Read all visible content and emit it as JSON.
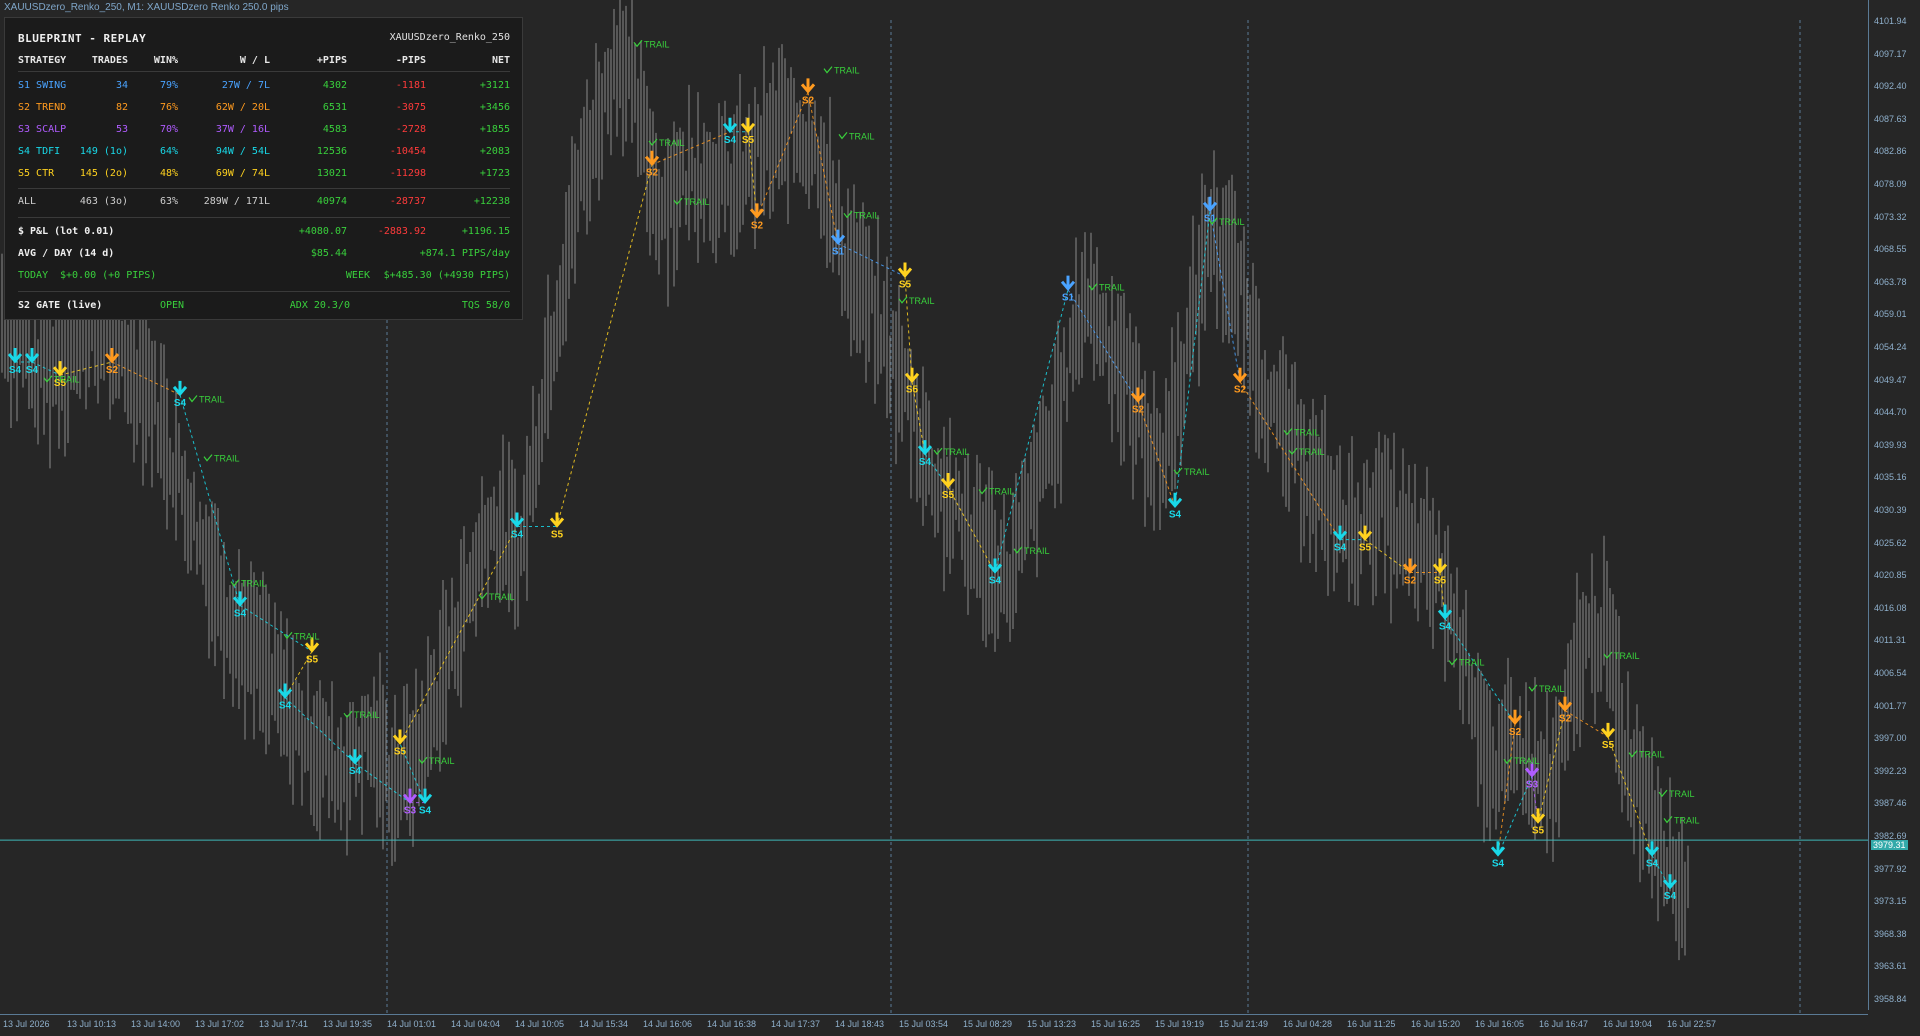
{
  "window": {
    "title": "XAUUSDzero_Renko_250, M1:  XAUUSDzero Renko 250.0 pips"
  },
  "panel": {
    "title": "BLUEPRINT - REPLAY",
    "symbol": "XAUUSDzero_Renko_250",
    "headers": [
      "STRATEGY",
      "TRADES",
      "WIN%",
      "W / L",
      "+PIPS",
      "-PIPS",
      "NET"
    ],
    "rows": [
      {
        "strategy": "S1 SWING",
        "trades": "34",
        "win": "79%",
        "wl": "27W / 7L",
        "plus": "4302",
        "minus": "-1181",
        "net": "+3121",
        "color": "#4aa3ff"
      },
      {
        "strategy": "S2 TREND",
        "trades": "82",
        "win": "76%",
        "wl": "62W / 20L",
        "plus": "6531",
        "minus": "-3075",
        "net": "+3456",
        "color": "#ff9a1f"
      },
      {
        "strategy": "S3 SCALP",
        "trades": "53",
        "win": "70%",
        "wl": "37W / 16L",
        "plus": "4583",
        "minus": "-2728",
        "net": "+1855",
        "color": "#b05cff"
      },
      {
        "strategy": "S4 TDFI",
        "trades": "149 (1o)",
        "win": "64%",
        "wl": "94W / 54L",
        "plus": "12536",
        "minus": "-10454",
        "net": "+2083",
        "color": "#19d8e8"
      },
      {
        "strategy": "S5 CTR",
        "trades": "145 (2o)",
        "win": "48%",
        "wl": "69W / 74L",
        "plus": "13021",
        "minus": "-11298",
        "net": "+1723",
        "color": "#ffd21f"
      }
    ],
    "total": {
      "strategy": "ALL",
      "trades": "463 (3o)",
      "win": "63%",
      "wl": "289W / 171L",
      "plus": "40974",
      "minus": "-28737",
      "net": "+12238"
    },
    "pnl": {
      "label": "$ P&L (lot 0.01)",
      "plus": "+4080.07",
      "minus": "-2883.92",
      "net": "+1196.15"
    },
    "avg": {
      "label": "AVG / DAY (14 d)",
      "value": "$85.44",
      "pips": "+874.1 PIPS/day"
    },
    "today": {
      "label": "TODAY",
      "value": "$+0.00 (+0 PIPS)",
      "week_label": "WEEK",
      "week_value": "$+485.30 (+4930 PIPS)"
    },
    "gate": {
      "label": "S2 GATE (live)",
      "status": "OPEN",
      "adx": "ADX 20.3/0",
      "tqs": "TQS 58/0"
    }
  },
  "axis": {
    "prices": [
      "4101.94",
      "4097.17",
      "4092.40",
      "4087.63",
      "4082.86",
      "4078.09",
      "4073.32",
      "4068.55",
      "4063.78",
      "4059.01",
      "4054.24",
      "4049.47",
      "4044.70",
      "4039.93",
      "4035.16",
      "4030.39",
      "4025.62",
      "4020.85",
      "4016.08",
      "4011.31",
      "4006.54",
      "4001.77",
      "3997.00",
      "3992.23",
      "3987.46",
      "3982.69",
      "3977.92",
      "3973.15",
      "3968.38",
      "3963.61",
      "3958.84"
    ],
    "current_price": "3979.31",
    "times": [
      "13 Jul 2026",
      "13 Jul 10:13",
      "13 Jul 14:00",
      "13 Jul 17:02",
      "13 Jul 17:41",
      "13 Jul 19:35",
      "14 Jul 01:01",
      "14 Jul 04:04",
      "14 Jul 10:05",
      "14 Jul 15:34",
      "14 Jul 16:06",
      "14 Jul 16:38",
      "14 Jul 17:37",
      "14 Jul 18:43",
      "15 Jul 03:54",
      "15 Jul 08:29",
      "15 Jul 13:23",
      "15 Jul 16:25",
      "15 Jul 19:19",
      "15 Jul 21:49",
      "16 Jul 04:28",
      "16 Jul 11:25",
      "16 Jul 15:20",
      "16 Jul 16:05",
      "16 Jul 16:47",
      "16 Jul 19:04",
      "16 Jul 22:57"
    ]
  },
  "chart_data": {
    "type": "line",
    "xlabel": "",
    "ylabel": "",
    "ylim": [
      3955,
      4104
    ],
    "current_price": 3979.31,
    "price_path": [
      [
        0,
        4060
      ],
      [
        40,
        4050
      ],
      [
        100,
        4058
      ],
      [
        150,
        4048
      ],
      [
        200,
        4025
      ],
      [
        235,
        4012
      ],
      [
        270,
        4004
      ],
      [
        300,
        3996
      ],
      [
        340,
        3990
      ],
      [
        370,
        3995
      ],
      [
        395,
        3988
      ],
      [
        420,
        3993
      ],
      [
        450,
        4008
      ],
      [
        490,
        4028
      ],
      [
        520,
        4022
      ],
      [
        545,
        4050
      ],
      [
        580,
        4080
      ],
      [
        620,
        4100
      ],
      [
        640,
        4088
      ],
      [
        660,
        4076
      ],
      [
        700,
        4082
      ],
      [
        730,
        4078
      ],
      [
        760,
        4084
      ],
      [
        790,
        4088
      ],
      [
        820,
        4084
      ],
      [
        840,
        4070
      ],
      [
        880,
        4057
      ],
      [
        910,
        4046
      ],
      [
        935,
        4034
      ],
      [
        960,
        4028
      ],
      [
        990,
        4022
      ],
      [
        1010,
        4019
      ],
      [
        1030,
        4030
      ],
      [
        1060,
        4045
      ],
      [
        1085,
        4063
      ],
      [
        1110,
        4055
      ],
      [
        1140,
        4044
      ],
      [
        1160,
        4036
      ],
      [
        1185,
        4052
      ],
      [
        1210,
        4073
      ],
      [
        1240,
        4063
      ],
      [
        1270,
        4045
      ],
      [
        1300,
        4038
      ],
      [
        1320,
        4032
      ],
      [
        1350,
        4026
      ],
      [
        1380,
        4030
      ],
      [
        1410,
        4024
      ],
      [
        1440,
        4020
      ],
      [
        1470,
        4005
      ],
      [
        1495,
        3985
      ],
      [
        1510,
        3996
      ],
      [
        1530,
        3990
      ],
      [
        1555,
        3987
      ],
      [
        1580,
        4008
      ],
      [
        1605,
        4012
      ],
      [
        1625,
        3993
      ],
      [
        1650,
        3985
      ],
      [
        1680,
        3972
      ]
    ],
    "signals": [
      {
        "label": "S4",
        "x": 15,
        "y": 4052,
        "color": "#19d8e8"
      },
      {
        "label": "S4",
        "x": 32,
        "y": 4052,
        "color": "#19d8e8"
      },
      {
        "label": "S5",
        "x": 60,
        "y": 4050,
        "color": "#ffd21f"
      },
      {
        "label": "S2",
        "x": 112,
        "y": 4052,
        "color": "#ff9a1f"
      },
      {
        "label": "S4",
        "x": 180,
        "y": 4047,
        "color": "#19d8e8"
      },
      {
        "label": "S4",
        "x": 240,
        "y": 4015,
        "color": "#19d8e8"
      },
      {
        "label": "S5",
        "x": 312,
        "y": 4008,
        "color": "#ffd21f"
      },
      {
        "label": "S4",
        "x": 285,
        "y": 4001,
        "color": "#19d8e8"
      },
      {
        "label": "S4",
        "x": 355,
        "y": 3991,
        "color": "#19d8e8"
      },
      {
        "label": "S3",
        "x": 410,
        "y": 3985,
        "color": "#b05cff"
      },
      {
        "label": "S4",
        "x": 425,
        "y": 3985,
        "color": "#19d8e8"
      },
      {
        "label": "S5",
        "x": 400,
        "y": 3994,
        "color": "#ffd21f"
      },
      {
        "label": "S4",
        "x": 517,
        "y": 4027,
        "color": "#19d8e8"
      },
      {
        "label": "S5",
        "x": 557,
        "y": 4027,
        "color": "#ffd21f"
      },
      {
        "label": "S2",
        "x": 652,
        "y": 4082,
        "color": "#ff9a1f"
      },
      {
        "label": "S4",
        "x": 730,
        "y": 4087,
        "color": "#19d8e8"
      },
      {
        "label": "S5",
        "x": 748,
        "y": 4087,
        "color": "#ffd21f"
      },
      {
        "label": "S2",
        "x": 757,
        "y": 4074,
        "color": "#ff9a1f"
      },
      {
        "label": "S2",
        "x": 808,
        "y": 4093,
        "color": "#ff9a1f"
      },
      {
        "label": "S1",
        "x": 838,
        "y": 4070,
        "color": "#4aa3ff"
      },
      {
        "label": "S5",
        "x": 905,
        "y": 4065,
        "color": "#ffd21f"
      },
      {
        "label": "S5",
        "x": 912,
        "y": 4049,
        "color": "#ffd21f"
      },
      {
        "label": "S4",
        "x": 925,
        "y": 4038,
        "color": "#19d8e8"
      },
      {
        "label": "S5",
        "x": 948,
        "y": 4033,
        "color": "#ffd21f"
      },
      {
        "label": "S4",
        "x": 995,
        "y": 4020,
        "color": "#19d8e8"
      },
      {
        "label": "S1",
        "x": 1068,
        "y": 4063,
        "color": "#4aa3ff"
      },
      {
        "label": "S2",
        "x": 1138,
        "y": 4046,
        "color": "#ff9a1f"
      },
      {
        "label": "S4",
        "x": 1175,
        "y": 4030,
        "color": "#19d8e8"
      },
      {
        "label": "S1",
        "x": 1210,
        "y": 4075,
        "color": "#4aa3ff"
      },
      {
        "label": "S2",
        "x": 1240,
        "y": 4049,
        "color": "#ff9a1f"
      },
      {
        "label": "S4",
        "x": 1340,
        "y": 4025,
        "color": "#19d8e8"
      },
      {
        "label": "S5",
        "x": 1365,
        "y": 4025,
        "color": "#ffd21f"
      },
      {
        "label": "S2",
        "x": 1410,
        "y": 4020,
        "color": "#ff9a1f"
      },
      {
        "label": "S5",
        "x": 1440,
        "y": 4020,
        "color": "#ffd21f"
      },
      {
        "label": "S4",
        "x": 1445,
        "y": 4013,
        "color": "#19d8e8"
      },
      {
        "label": "S2",
        "x": 1515,
        "y": 3997,
        "color": "#ff9a1f"
      },
      {
        "label": "S4",
        "x": 1498,
        "y": 3977,
        "color": "#19d8e8"
      },
      {
        "label": "S3",
        "x": 1532,
        "y": 3989,
        "color": "#b05cff"
      },
      {
        "label": "S5",
        "x": 1538,
        "y": 3982,
        "color": "#ffd21f"
      },
      {
        "label": "S2",
        "x": 1565,
        "y": 3999,
        "color": "#ff9a1f"
      },
      {
        "label": "S5",
        "x": 1608,
        "y": 3995,
        "color": "#ffd21f"
      },
      {
        "label": "S4",
        "x": 1652,
        "y": 3977,
        "color": "#19d8e8"
      },
      {
        "label": "S4",
        "x": 1670,
        "y": 3972,
        "color": "#19d8e8"
      }
    ],
    "trail_label": "TRAIL",
    "trails": [
      [
        50,
        4049
      ],
      [
        195,
        4046
      ],
      [
        210,
        4037
      ],
      [
        237,
        4018
      ],
      [
        290,
        4010
      ],
      [
        350,
        3998
      ],
      [
        425,
        3991
      ],
      [
        485,
        4016
      ],
      [
        640,
        4100
      ],
      [
        655,
        4085
      ],
      [
        680,
        4076
      ],
      [
        830,
        4096
      ],
      [
        845,
        4086
      ],
      [
        850,
        4074
      ],
      [
        905,
        4061
      ],
      [
        940,
        4038
      ],
      [
        985,
        4032
      ],
      [
        1020,
        4023
      ],
      [
        1095,
        4063
      ],
      [
        1180,
        4035
      ],
      [
        1215,
        4073
      ],
      [
        1290,
        4041
      ],
      [
        1295,
        4038
      ],
      [
        1455,
        4006
      ],
      [
        1510,
        3991
      ],
      [
        1535,
        4002
      ],
      [
        1610,
        4007
      ],
      [
        1635,
        3992
      ],
      [
        1665,
        3986
      ],
      [
        1670,
        3982
      ]
    ]
  }
}
